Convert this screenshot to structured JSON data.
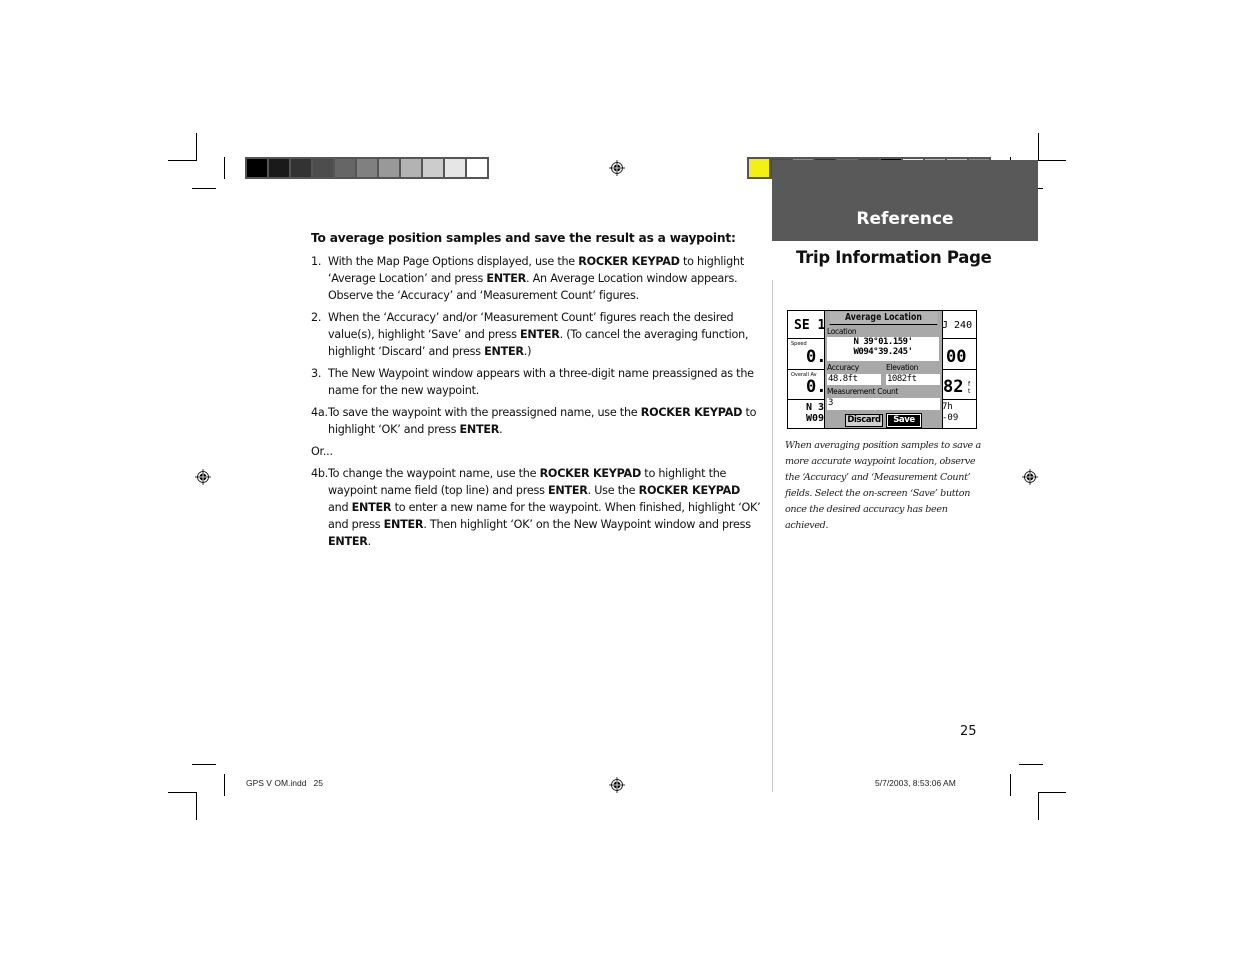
{
  "color_bars": {
    "grayscale": [
      "#000000",
      "#1a1a1a",
      "#333333",
      "#4d4d4d",
      "#666666",
      "#808080",
      "#999999",
      "#b3b3b3",
      "#cccccc",
      "#e6e6e6",
      "#ffffff"
    ],
    "process": [
      "#f5f013",
      "#c0077a",
      "#37a9e9",
      "#3a1a7a",
      "#20a24a",
      "#c6002b",
      "#000000",
      "#fbf59b",
      "#e4a2c0",
      "#a1cdef",
      "#8e8e8e"
    ]
  },
  "main": {
    "heading": "To average position samples and save the result as a waypoint:",
    "steps": [
      {
        "num": "1.",
        "parts": [
          {
            "t": "With the Map Page Options displayed, use the "
          },
          {
            "t": "ROCKER KEYPAD",
            "b": true
          },
          {
            "t": " to highlight ‘Average Location’ and press "
          },
          {
            "t": "ENTER",
            "b": true
          },
          {
            "t": ". An Average Location window appears. Observe the ‘Accuracy’ and ‘Measurement Count’ figures."
          }
        ]
      },
      {
        "num": "2.",
        "parts": [
          {
            "t": "When the ‘Accuracy’ and/or ‘Measurement Count’ figures reach the desired value(s), highlight ‘Save’ and press "
          },
          {
            "t": "ENTER",
            "b": true
          },
          {
            "t": ". (To cancel the averaging function, highlight ‘Discard’ and press "
          },
          {
            "t": "ENTER",
            "b": true
          },
          {
            "t": ".)"
          }
        ]
      },
      {
        "num": "3.",
        "parts": [
          {
            "t": "The New Waypoint window appears with a three-digit name preassigned as the name for the new waypoint."
          }
        ]
      },
      {
        "num": "4a.",
        "parts": [
          {
            "t": "To save the waypoint with the preassigned name, use the "
          },
          {
            "t": "ROCKER KEYPAD",
            "b": true
          },
          {
            "t": " to highlight ‘OK’ and press "
          },
          {
            "t": "ENTER",
            "b": true
          },
          {
            "t": "."
          }
        ]
      }
    ],
    "or_text": "Or...",
    "step_4b": {
      "num": "4b.",
      "parts": [
        {
          "t": "To change the waypoint name, use the "
        },
        {
          "t": "ROCKER KEYPAD",
          "b": true
        },
        {
          "t": " to highlight the waypoint name field (top line) and press "
        },
        {
          "t": "ENTER",
          "b": true
        },
        {
          "t": ". Use the "
        },
        {
          "t": "ROCKER KEYPAD",
          "b": true
        },
        {
          "t": " and "
        },
        {
          "t": "ENTER",
          "b": true
        },
        {
          "t": " to enter a new name for the waypoint. When finished, highlight ‘OK’ and press "
        },
        {
          "t": "ENTER",
          "b": true
        },
        {
          "t": ". Then highlight ‘OK’ on the New Waypoint window and press "
        },
        {
          "t": "ENTER",
          "b": true
        },
        {
          "t": "."
        }
      ]
    }
  },
  "sidebar": {
    "tab_title": "Reference",
    "tab_color": "#595959",
    "section_title": "Trip Information Page",
    "caption": "When averaging position samples to save a more accurate waypoint location, observe the ‘Accuracy’ and ‘Measurement Count’ fields. Select the on-screen ‘Save’ button once the desired accuracy has been achieved."
  },
  "gps_screen": {
    "background": {
      "heading_left": "SE 1",
      "heading_right": "J 240",
      "speed_label": "Speed",
      "speed_value": "0.(",
      "overall_label": "Overall Av",
      "overall_value": "0.(",
      "pos_left_1": "N 3",
      "pos_left_2": "W09",
      "right_value_1": "00",
      "right_value_2": "82",
      "right_units_2": "ft",
      "right_small_1": "7h",
      "right_small_2": "-09"
    },
    "dialog": {
      "title": "Average Location",
      "location_label": "Location",
      "lat": "N  39°01.159'",
      "lon": "W094°39.245'",
      "accuracy_label": "Accuracy",
      "accuracy_value": "48.8ft",
      "elevation_label": "Elevation",
      "elevation_value": "1082ft",
      "count_label": "Measurement Count",
      "count_value": "3",
      "discard_label": "Discard",
      "save_label": "Save"
    }
  },
  "footer": {
    "page_number": "25",
    "slug_file": "GPS V OM.indd   25",
    "slug_date": "5/7/2003, 8:53:06 AM"
  }
}
